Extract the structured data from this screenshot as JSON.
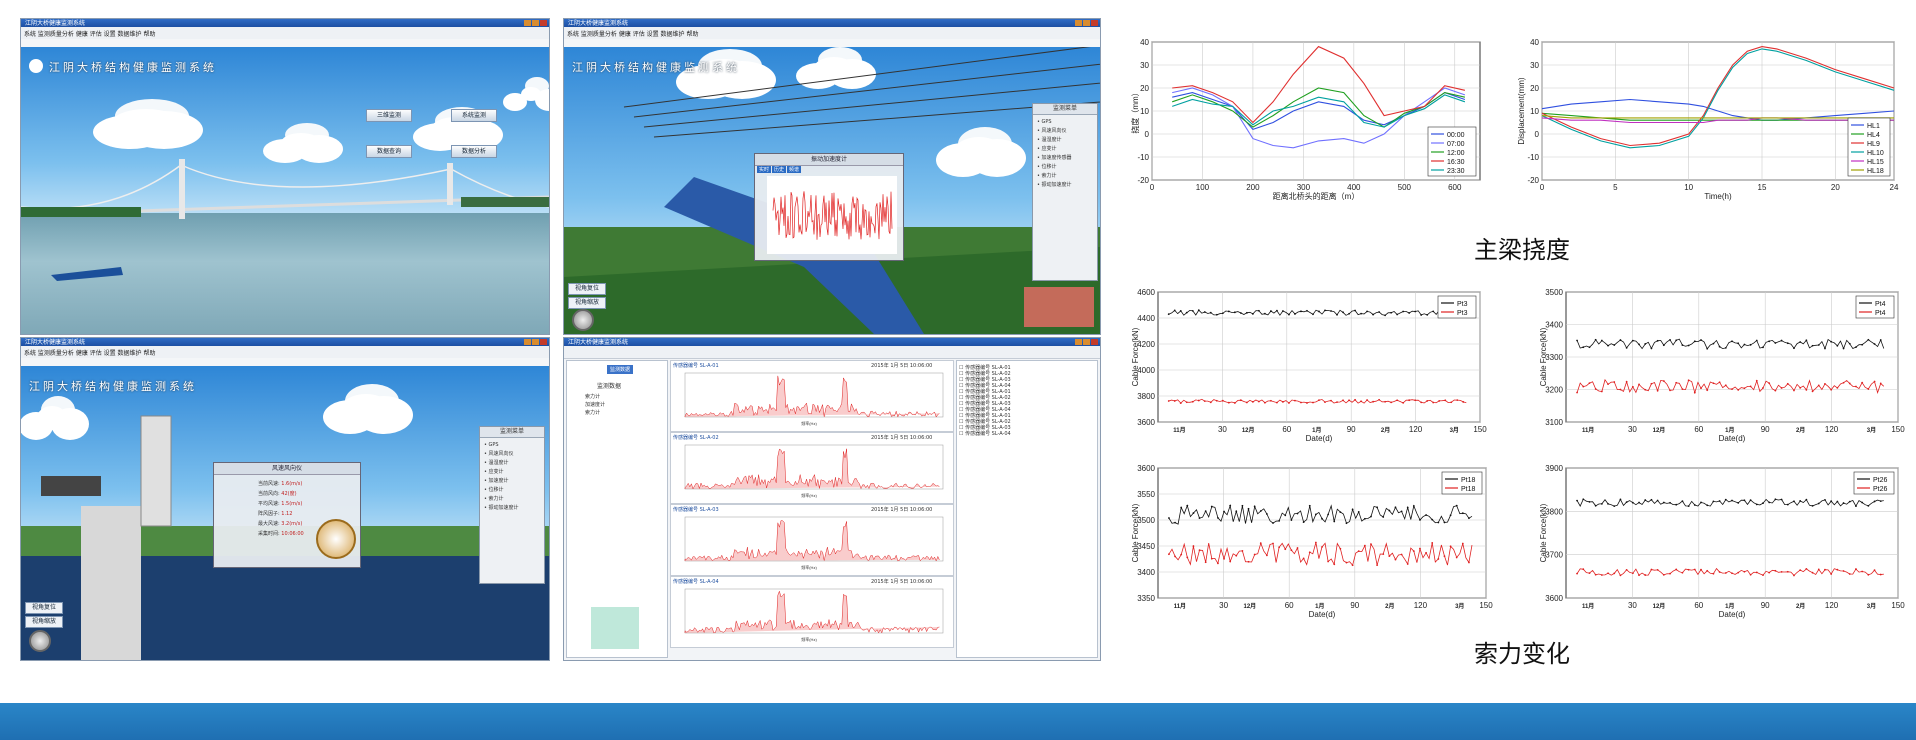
{
  "screens": {
    "main": {
      "window_title": "江阴大桥健康监测系统",
      "menu": "系统 监测质量分析 健康 评估 设置 数据维护 帮助",
      "title": "江阴大桥结构健康监测系统",
      "buttons": [
        "三维监测",
        "系统监测",
        "数据查询",
        "数据分析"
      ]
    },
    "accel": {
      "window_title": "江阴大桥健康监测系统",
      "menu": "系统 监测质量分析 健康 评估 设置 数据维护 帮助",
      "title": "江阴大桥结构健康监测系统",
      "popup_title": "振动加速度计",
      "popup_tabs": [
        "实时",
        "历史",
        "频谱"
      ],
      "panel_title": "监测菜单",
      "menu_items": [
        "GPS",
        "风速风向仪",
        "温湿度计",
        "应变计",
        "加速度传感器",
        "位移计",
        "索力计",
        "振动加速度计"
      ],
      "nav_buttons": [
        "视角复位",
        "视角缩放"
      ]
    },
    "wind": {
      "window_title": "江阴大桥健康监测系统",
      "menu": "系统 监测质量分析 健康 评估 设置 数据维护 帮助",
      "title": "江阴大桥结构健康监测系统",
      "popup_title": "风速风向仪",
      "readings": [
        {
          "label": "当前风速",
          "value": "1.6(m/s)"
        },
        {
          "label": "当前风向",
          "value": "42(度)"
        },
        {
          "label": "平均风速",
          "value": "1.5(m/s)"
        },
        {
          "label": "阵风因子",
          "value": "1.12"
        },
        {
          "label": "最大风速",
          "value": "3.2(m/s)"
        },
        {
          "label": "采集时间",
          "value": "10:06:00"
        }
      ],
      "panel_title": "监测菜单",
      "menu_items": [
        "GPS",
        "风速风向仪",
        "温湿度计",
        "应变计",
        "加速度计",
        "位移计",
        "索力计",
        "振动加速度计"
      ],
      "nav_buttons": [
        "视角复位",
        "视角缩放"
      ]
    },
    "spectrum": {
      "window_title": "江阴大桥健康监测系统",
      "tree_root": "监测数据",
      "tree_items": [
        "索力计",
        "加速度计",
        "索力计"
      ],
      "top_tab": "监测数据",
      "rows": [
        {
          "label": "传感器编号 SL-A-01",
          "date": "2015年 1月 5日",
          "time": "10:06:00"
        },
        {
          "label": "传感器编号 SL-A-02",
          "date": "2015年 1月 5日",
          "time": "10:06:00"
        },
        {
          "label": "传感器编号 SL-A-03",
          "date": "2015年 1月 5日",
          "time": "10:06:00"
        },
        {
          "label": "传感器编号 SL-A-04",
          "date": "2015年 1月 5日",
          "time": "10:06:00"
        }
      ],
      "xlabel": "频率(Hz)"
    }
  },
  "charts": {
    "deflection_dist": {
      "type": "line",
      "xlabel": "距离北桥头的距离（m）",
      "ylabel": "挠度（mm）",
      "xlim": [
        0,
        650
      ],
      "ylim": [
        -20,
        40
      ],
      "xticks": [
        0,
        100,
        200,
        300,
        400,
        500,
        600
      ],
      "yticks": [
        -20,
        -10,
        0,
        10,
        20,
        30,
        40
      ],
      "x": [
        40,
        80,
        120,
        160,
        200,
        240,
        280,
        330,
        380,
        420,
        460,
        500,
        540,
        580,
        620
      ],
      "series": [
        {
          "name": "00:00",
          "color": "#3050e0",
          "values": [
            16,
            18,
            15,
            12,
            2,
            5,
            10,
            14,
            12,
            6,
            4,
            8,
            12,
            18,
            15
          ]
        },
        {
          "name": "07:00",
          "color": "#7070ff",
          "values": [
            18,
            20,
            17,
            12,
            -2,
            -5,
            -6,
            -3,
            -2,
            -4,
            0,
            8,
            14,
            20,
            17
          ]
        },
        {
          "name": "12:00",
          "color": "#20a020",
          "values": [
            14,
            17,
            14,
            10,
            3,
            8,
            14,
            20,
            18,
            8,
            3,
            9,
            12,
            18,
            16
          ]
        },
        {
          "name": "16:30",
          "color": "#e03030",
          "values": [
            20,
            21,
            18,
            14,
            5,
            14,
            26,
            38,
            33,
            22,
            8,
            10,
            12,
            21,
            19
          ]
        },
        {
          "name": "23:30",
          "color": "#00a0a0",
          "values": [
            12,
            15,
            13,
            12,
            4,
            10,
            12,
            16,
            14,
            5,
            3,
            8,
            11,
            17,
            14
          ]
        }
      ]
    },
    "deflection_time": {
      "type": "line",
      "xlabel": "Time(h)",
      "ylabel": "Displacement(mm)",
      "xlim": [
        0,
        24
      ],
      "ylim": [
        -20,
        40
      ],
      "xticks": [
        0,
        5,
        10,
        15,
        20,
        24
      ],
      "yticks": [
        -20,
        -10,
        0,
        10,
        20,
        30,
        40
      ],
      "x": [
        0,
        2,
        4,
        6,
        8,
        10,
        11,
        12,
        13,
        14,
        15,
        16,
        18,
        20,
        22,
        24
      ],
      "series": [
        {
          "name": "HL1",
          "color": "#3050e0",
          "values": [
            11,
            13,
            14,
            15,
            14,
            13,
            12,
            10,
            8,
            7,
            6,
            6,
            7,
            8,
            9,
            10
          ]
        },
        {
          "name": "HL4",
          "color": "#20a020",
          "values": [
            9,
            8,
            7,
            6,
            6,
            6,
            6,
            6,
            6,
            6,
            6,
            6,
            6,
            6,
            6,
            6
          ]
        },
        {
          "name": "HL9",
          "color": "#e03030",
          "values": [
            9,
            3,
            -2,
            -5,
            -4,
            0,
            8,
            20,
            30,
            36,
            38,
            37,
            33,
            28,
            24,
            20
          ]
        },
        {
          "name": "HL10",
          "color": "#00a0a0",
          "values": [
            8,
            2,
            -3,
            -6,
            -5,
            -1,
            7,
            19,
            29,
            35,
            37,
            36,
            32,
            27,
            23,
            19
          ]
        },
        {
          "name": "HL15",
          "color": "#c030c0",
          "values": [
            7,
            6,
            6,
            5,
            5,
            5,
            5,
            6,
            6,
            6,
            7,
            7,
            6,
            6,
            6,
            6
          ]
        },
        {
          "name": "HL18",
          "color": "#a0a000",
          "values": [
            8,
            7,
            7,
            7,
            7,
            7,
            7,
            7,
            7,
            7,
            7,
            7,
            7,
            7,
            7,
            7
          ]
        }
      ]
    },
    "cable_pt3": {
      "type": "line",
      "xlabel": "Date(d)",
      "ylabel": "Cable Force(kN)",
      "xlim": [
        0,
        150
      ],
      "ylim": [
        3600,
        4600
      ],
      "xticks": [
        30,
        60,
        90,
        120,
        150
      ],
      "yticks": [
        3600,
        3800,
        4000,
        4200,
        4400,
        4600
      ],
      "month_labels": [
        "11月",
        "12月",
        "1月",
        "2月",
        "3月"
      ],
      "series": [
        {
          "name": "Pt3",
          "color": "#111111",
          "base": 4440,
          "amp": 20,
          "seed": 3
        },
        {
          "name": "Pt3",
          "color": "#e02020",
          "base": 3760,
          "amp": 15,
          "seed": 7
        }
      ]
    },
    "cable_pt4": {
      "type": "line",
      "xlabel": "Date(d)",
      "ylabel": "Cable Force(kN)",
      "xlim": [
        0,
        150
      ],
      "ylim": [
        3100,
        3500
      ],
      "xticks": [
        30,
        60,
        90,
        120,
        150
      ],
      "yticks": [
        3100,
        3200,
        3300,
        3400,
        3500
      ],
      "month_labels": [
        "11月",
        "12月",
        "1月",
        "2月",
        "3月"
      ],
      "series": [
        {
          "name": "Pt4",
          "color": "#111111",
          "base": 3340,
          "amp": 15,
          "seed": 11
        },
        {
          "name": "Pt4",
          "color": "#e02020",
          "base": 3210,
          "amp": 20,
          "seed": 13
        }
      ]
    },
    "cable_pt18": {
      "type": "line",
      "xlabel": "Date(d)",
      "ylabel": "Cable Force(kN)",
      "xlim": [
        0,
        150
      ],
      "ylim": [
        3350,
        3600
      ],
      "xticks": [
        30,
        60,
        90,
        120,
        150
      ],
      "yticks": [
        3350,
        3400,
        3450,
        3500,
        3550,
        3600
      ],
      "month_labels": [
        "11月",
        "12月",
        "1月",
        "2月",
        "3月"
      ],
      "series": [
        {
          "name": "Pt18",
          "color": "#111111",
          "base": 3510,
          "amp": 18,
          "seed": 17
        },
        {
          "name": "Pt18",
          "color": "#e02020",
          "base": 3435,
          "amp": 22,
          "seed": 19
        }
      ]
    },
    "cable_pt26": {
      "type": "line",
      "xlabel": "Date(d)",
      "ylabel": "Cable Force(kN)",
      "xlim": [
        0,
        150
      ],
      "ylim": [
        3600,
        3900
      ],
      "xticks": [
        30,
        60,
        90,
        120,
        150
      ],
      "yticks": [
        3600,
        3700,
        3800,
        3900
      ],
      "month_labels": [
        "11月",
        "12月",
        "1月",
        "2月",
        "3月"
      ],
      "series": [
        {
          "name": "Pt26",
          "color": "#111111",
          "base": 3820,
          "amp": 8,
          "seed": 23
        },
        {
          "name": "Pt26",
          "color": "#e02020",
          "base": 3660,
          "amp": 8,
          "seed": 29
        }
      ]
    }
  },
  "captions": {
    "deflection": "主梁挠度",
    "cable": "索力变化"
  }
}
